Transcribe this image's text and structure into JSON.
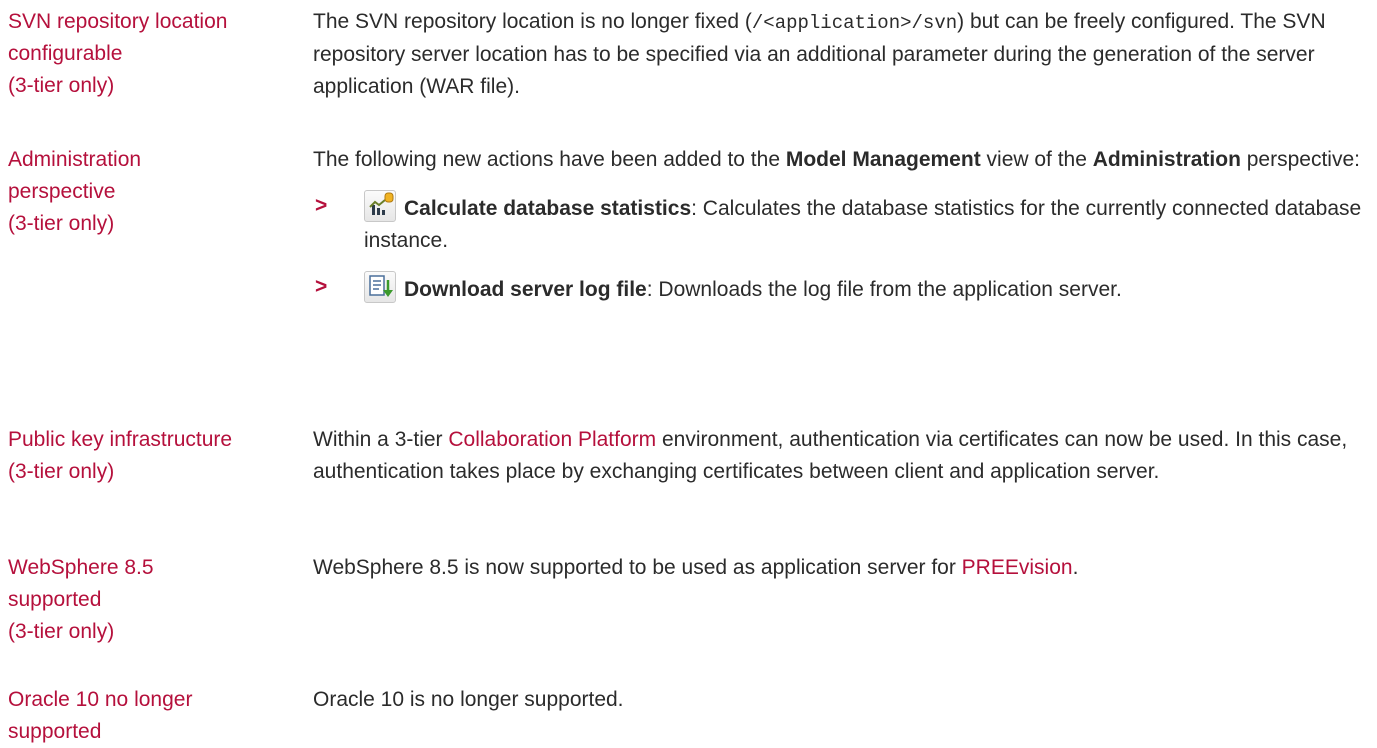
{
  "entries": [
    {
      "term": [
        "SVN repository location",
        "configurable",
        "(3-tier only)"
      ],
      "desc": {
        "t1": "The SVN repository location is no longer fixed (",
        "code": "/<application>/svn",
        "t2": ") but can be freely configured. The SVN repository server location has to be specified via an additional parameter during the generation of the server application (WAR file)."
      }
    },
    {
      "term": [
        "Administration",
        "perspective",
        "(3-tier only)"
      ],
      "desc": {
        "t1": "The following new actions have been added to the ",
        "b1": "Model Management",
        "t2": " view of the ",
        "b2": "Administration",
        "t3": " perspective:",
        "actions": [
          {
            "bullet": ">",
            "icon": "database-statistics-icon",
            "label": "Calculate database statistics",
            "text": ": Calculates the database statistics for the currently connected database instance."
          },
          {
            "bullet": ">",
            "icon": "download-log-icon",
            "label": "Download server log file",
            "text": ": Downloads the log file from the application server."
          }
        ]
      }
    },
    {
      "term": [
        "Public key infrastructure",
        "(3-tier only)"
      ],
      "desc": {
        "t1": "Within a 3-tier ",
        "link": "Collaboration Platform",
        "t2": " environment, authentication via certificates can now be used. In this case, authentication takes place by exchanging certificates between client and application server."
      }
    },
    {
      "term": [
        "WebSphere 8.5",
        "supported",
        "(3-tier only)"
      ],
      "desc": {
        "t1": "WebSphere 8.5 is now supported to be used as application server for ",
        "link": "PREEvision",
        "t2": "."
      }
    },
    {
      "term": [
        "Oracle 10 no longer",
        "supported"
      ],
      "desc": {
        "t1": "Oracle 10 is no longer supported."
      }
    }
  ],
  "colors": {
    "accent": "#b5103c",
    "text": "#2b2b2b"
  }
}
